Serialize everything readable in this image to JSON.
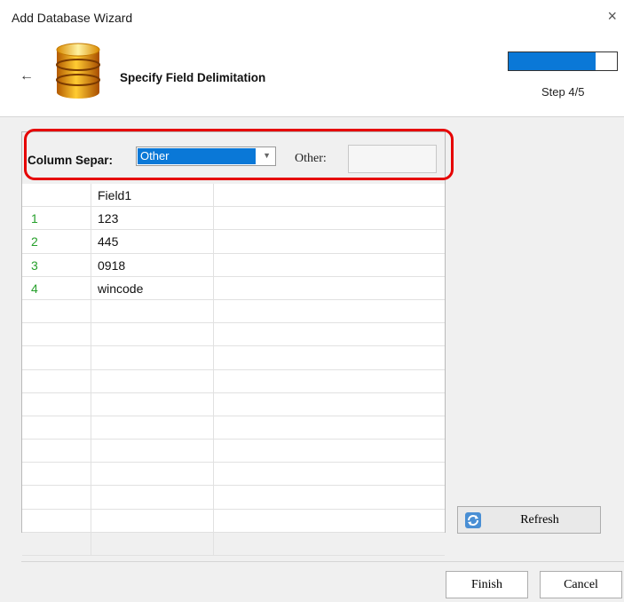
{
  "window": {
    "title": "Add Database Wizard",
    "close_glyph": "×"
  },
  "header": {
    "back_glyph": "←",
    "heading": "Specify Field Delimitation",
    "icon": "database-icon",
    "step_text": "Step 4/5",
    "progress_fraction": 0.8,
    "accent": "#0a78d7"
  },
  "separator": {
    "label": "Column Separ:",
    "selected": "Other",
    "other_label": "Other:",
    "other_value": ""
  },
  "table": {
    "columns": [
      "",
      "Field1",
      ""
    ],
    "rows": [
      {
        "num": "1",
        "field1": "123"
      },
      {
        "num": "2",
        "field1": "445"
      },
      {
        "num": "3",
        "field1": "0918"
      },
      {
        "num": "4",
        "field1": "wincode"
      },
      {
        "num": "",
        "field1": ""
      },
      {
        "num": "",
        "field1": ""
      },
      {
        "num": "",
        "field1": ""
      },
      {
        "num": "",
        "field1": ""
      },
      {
        "num": "",
        "field1": ""
      },
      {
        "num": "",
        "field1": ""
      },
      {
        "num": "",
        "field1": ""
      },
      {
        "num": "",
        "field1": ""
      },
      {
        "num": "",
        "field1": ""
      },
      {
        "num": "",
        "field1": ""
      },
      {
        "num": "",
        "field1": ""
      }
    ]
  },
  "refresh": {
    "label": "Refresh",
    "icon": "refresh-icon"
  },
  "footer": {
    "finish_label": "Finish",
    "cancel_label": "Cancel"
  }
}
